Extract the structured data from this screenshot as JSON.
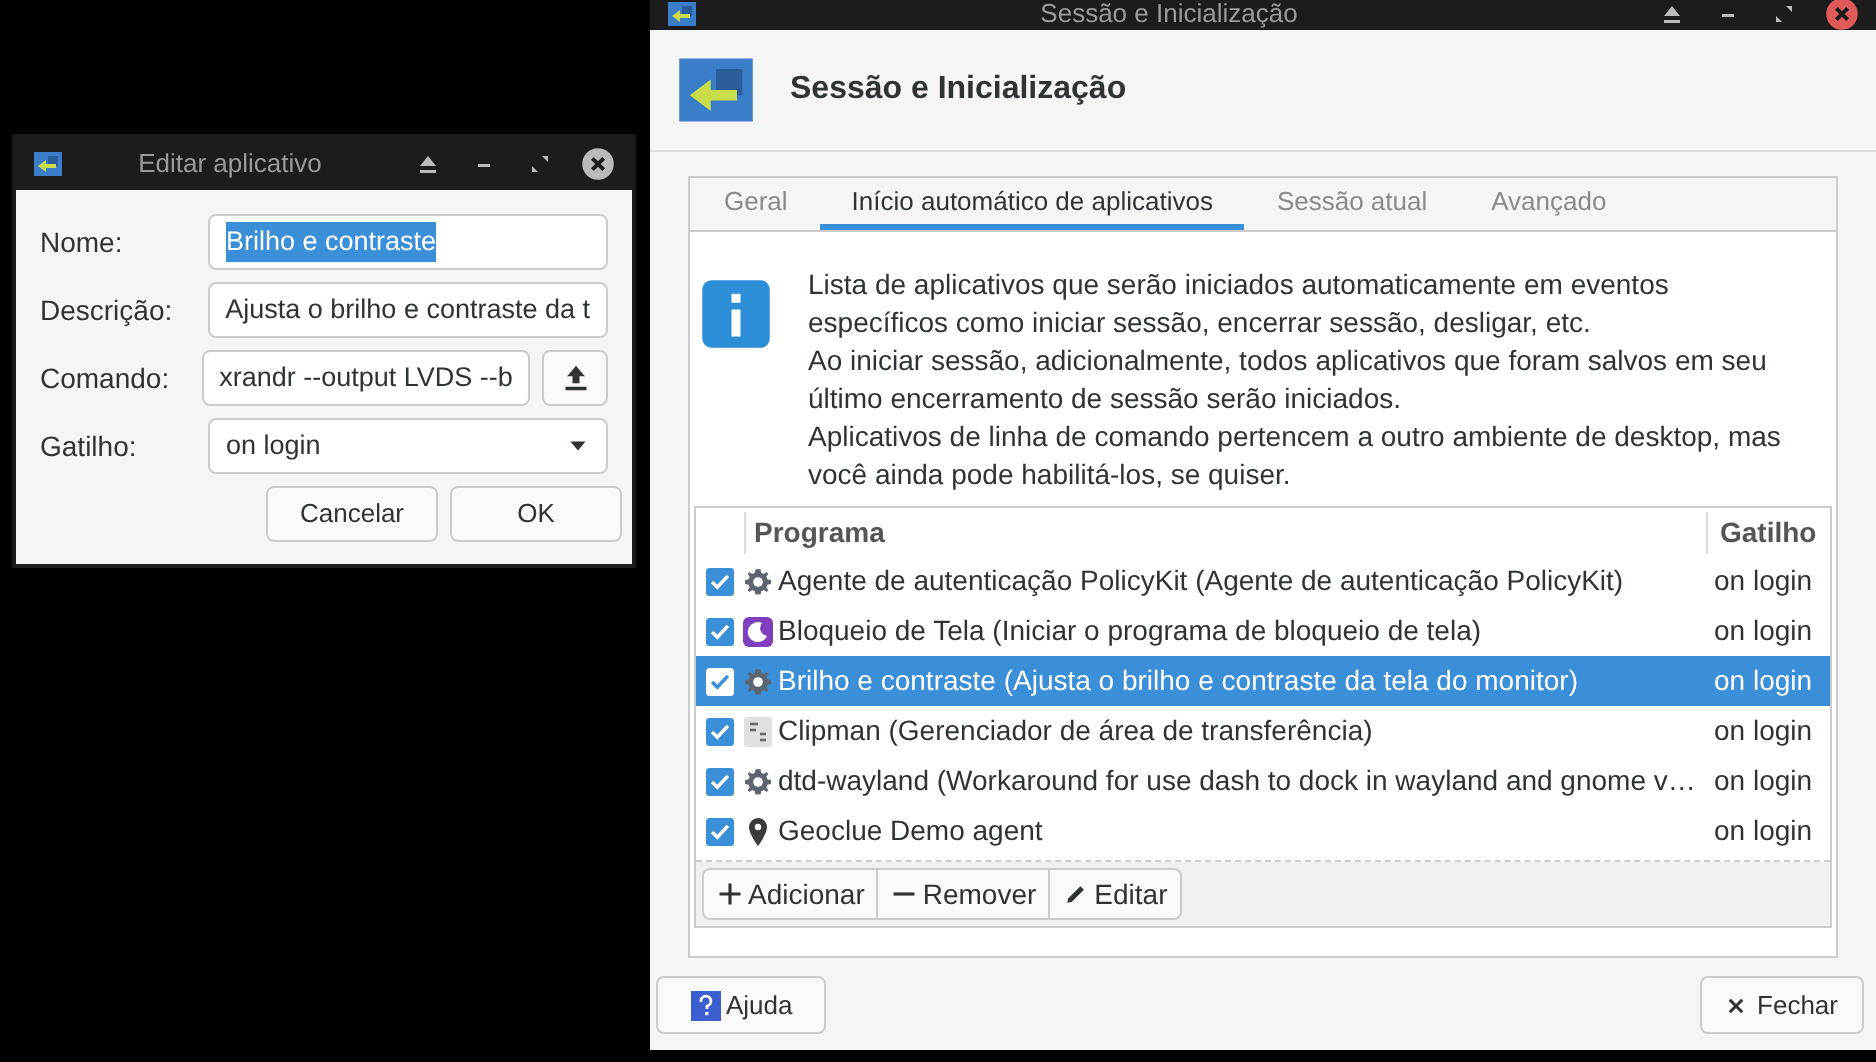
{
  "main_window": {
    "title": "Sessão e Inicialização",
    "header": "Sessão e Inicialização",
    "tabs": [
      {
        "label": "Geral",
        "selected": false
      },
      {
        "label": "Início automático de aplicativos",
        "selected": true
      },
      {
        "label": "Sessão atual",
        "selected": false
      },
      {
        "label": "Avançado",
        "selected": false
      }
    ],
    "info": [
      "Lista de aplicativos que serão iniciados automaticamente em eventos específicos como iniciar sessão, encerrar sessão, desligar, etc.",
      "Ao iniciar sessão, adicionalmente, todos aplicativos que foram salvos em seu último encerramento de sessão serão iniciados.",
      "Aplicativos de linha de comando pertencem a outro ambiente de desktop, mas você ainda pode habilitá-los, se quiser."
    ],
    "table": {
      "columns": [
        "Programa",
        "Gatilho"
      ],
      "rows": [
        {
          "checked": true,
          "kind": "gear",
          "program": "Agente de autenticação PolicyKit (Agente de autenticação PolicyKit)",
          "trigger": "on login",
          "selected": false
        },
        {
          "checked": true,
          "kind": "lock",
          "program": "Bloqueio de Tela (Iniciar o programa de bloqueio de tela)",
          "trigger": "on login",
          "selected": false
        },
        {
          "checked": true,
          "kind": "gear",
          "program": "Brilho e contraste (Ajusta o brilho e contraste da tela do monitor)",
          "trigger": "on login",
          "selected": true
        },
        {
          "checked": true,
          "kind": "clipboard",
          "program": "Clipman (Gerenciador de área de transferência)",
          "trigger": "on login",
          "selected": false
        },
        {
          "checked": true,
          "kind": "gear",
          "program": "dtd-wayland (Workaround for use dash to dock in wayland and gnome v…",
          "trigger": "on login",
          "selected": false
        },
        {
          "checked": true,
          "kind": "pin",
          "program": "Geoclue Demo agent",
          "trigger": "on login",
          "selected": false
        }
      ]
    },
    "list_buttons": [
      {
        "kind": "add",
        "label": "Adicionar"
      },
      {
        "kind": "remove",
        "label": "Remover"
      },
      {
        "kind": "edit",
        "label": "Editar"
      }
    ],
    "help_button": "Ajuda",
    "close_button": "Fechar"
  },
  "dialog": {
    "title": "Editar aplicativo",
    "fields": [
      {
        "label": "Nome:",
        "kind": "text",
        "value": "Brilho e contraste",
        "selected": true
      },
      {
        "label": "Descrição:",
        "kind": "text",
        "value": "Ajusta o brilho e contraste da t",
        "selected": false
      },
      {
        "label": "Comando:",
        "kind": "file",
        "value": "xrandr --output LVDS --b",
        "selected": false
      },
      {
        "label": "Gatilho:",
        "kind": "combo",
        "value": "on login",
        "selected": false
      }
    ],
    "buttons": [
      "Cancelar",
      "OK"
    ]
  }
}
